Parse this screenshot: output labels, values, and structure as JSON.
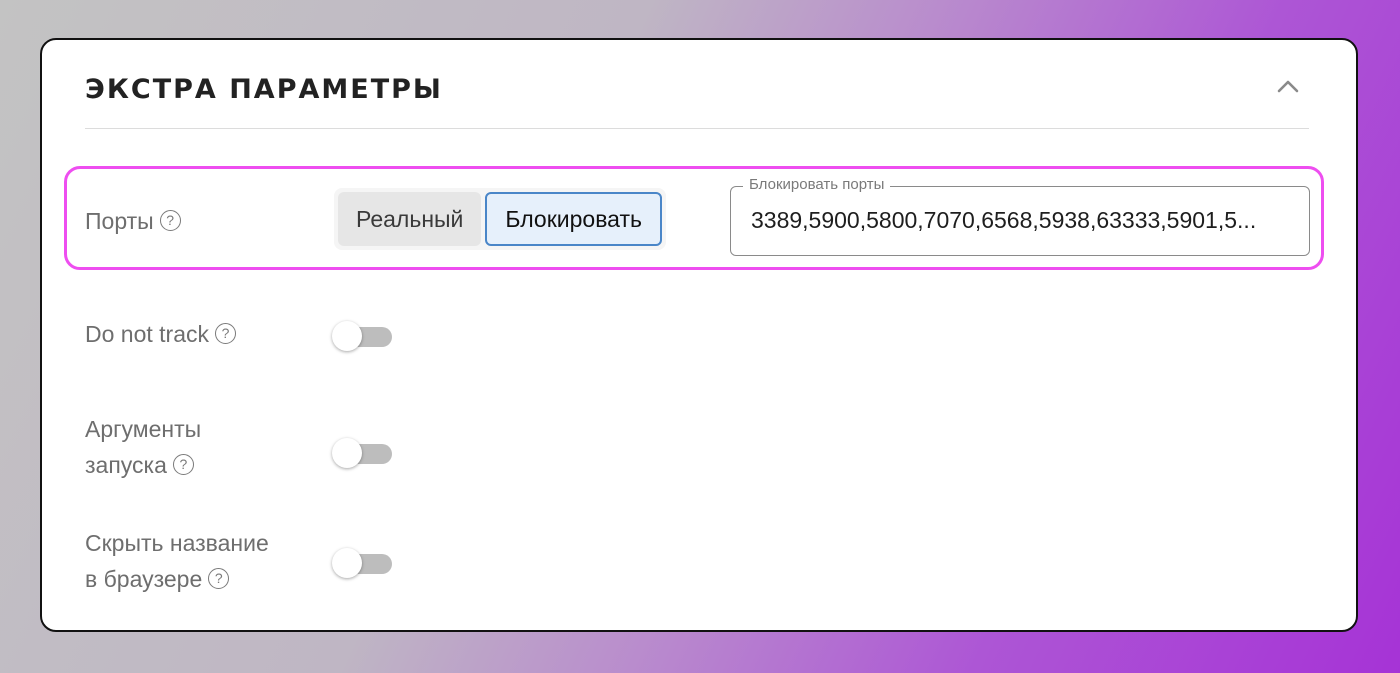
{
  "section": {
    "title": "ЭКСТРА ПАРАМЕТРЫ",
    "collapse_icon": "chevron-up-icon"
  },
  "ports": {
    "label": "Порты",
    "help_icon": "?",
    "options": [
      "Реальный",
      "Блокировать"
    ],
    "selected": "Блокировать",
    "field_label": "Блокировать порты",
    "field_value": "3389,5900,5800,7070,6568,5938,63333,5901,5..."
  },
  "settings": [
    {
      "label_lines": [
        "Do not track"
      ],
      "help_icon": "?",
      "enabled": false
    },
    {
      "label_lines": [
        "Аргументы",
        "запуска"
      ],
      "help_icon": "?",
      "enabled": false
    },
    {
      "label_lines": [
        "Скрыть название",
        "в браузере"
      ],
      "help_icon": "?",
      "enabled": false
    }
  ],
  "colors": {
    "highlight": "#ee4ef0",
    "selected_border": "#4a86c8",
    "selected_bg": "#e6f0fb",
    "toggle_off": "#bdbdbd"
  }
}
